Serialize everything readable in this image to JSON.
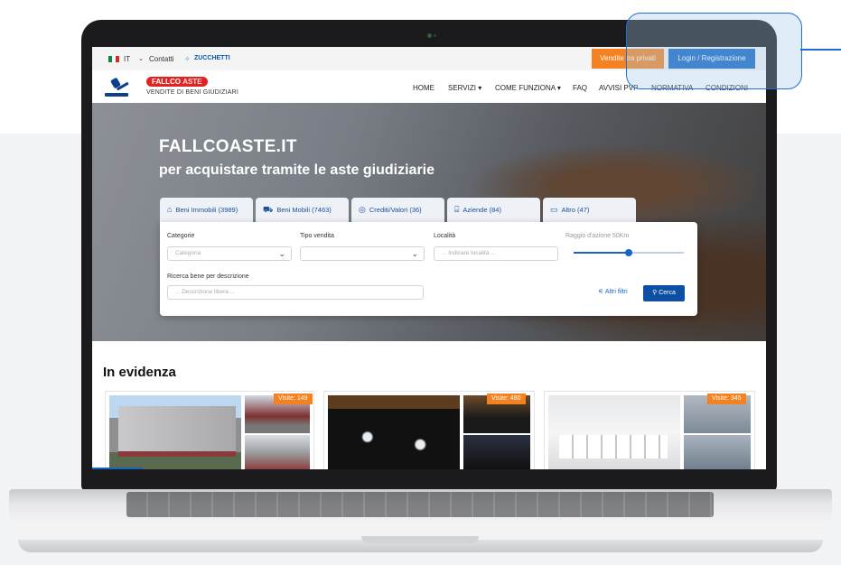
{
  "topbar": {
    "language": "IT",
    "contatti": "Contatti",
    "zucchetti": "ZUCCHETTI",
    "vendite_privati": "Vendite tra privati",
    "login": "Login / Registrazione"
  },
  "logo": {
    "brand_main": "FALLCO",
    "brand_accent": "ASTE",
    "tagline": "VENDITE DI BENI GIUDIZIARI"
  },
  "nav": {
    "items": [
      "HOME",
      "SERVIZI ▾",
      "COME FUNZIONA ▾",
      "FAQ",
      "AVVISI PVP",
      "NORMATIVA",
      "CONDIZIONI"
    ]
  },
  "hero": {
    "title": "FALLCOASTE.IT",
    "subtitle": "per acquistare tramite le aste giudiziarie"
  },
  "tabs": [
    {
      "label": "Beni Immobili",
      "count": "(3989)",
      "icon": "house-icon"
    },
    {
      "label": "Beni Mobili",
      "count": "(7463)",
      "icon": "car-icon"
    },
    {
      "label": "Crediti/Valori",
      "count": "(36)",
      "icon": "coin-icon"
    },
    {
      "label": "Aziende",
      "count": "(84)",
      "icon": "factory-icon"
    },
    {
      "label": "Altro",
      "count": "(47)",
      "icon": "calendar-icon"
    }
  ],
  "search": {
    "categorie_label": "Categorie",
    "categorie_placeholder": "Categoria",
    "tipo_label": "Tipo vendita",
    "localita_label": "Località",
    "localita_placeholder": "... Indicare località ...",
    "raggio_label": "Raggio d'azione 50Km",
    "raggio_fraction": 0.5,
    "descrizione_label": "Ricerca bene per descrizione",
    "descrizione_placeholder": "... Descrizione libera ...",
    "filtri": "Altri filtri",
    "cerca": "Cerca"
  },
  "evidenza": {
    "title": "In evidenza",
    "cards": [
      {
        "visite": "Visite: 149"
      },
      {
        "visite": "Visite: 480"
      },
      {
        "visite": "Visite: 345"
      }
    ]
  },
  "colors": {
    "primary_blue": "#1565c0",
    "orange": "#f58220",
    "brand_red": "#e02424"
  }
}
